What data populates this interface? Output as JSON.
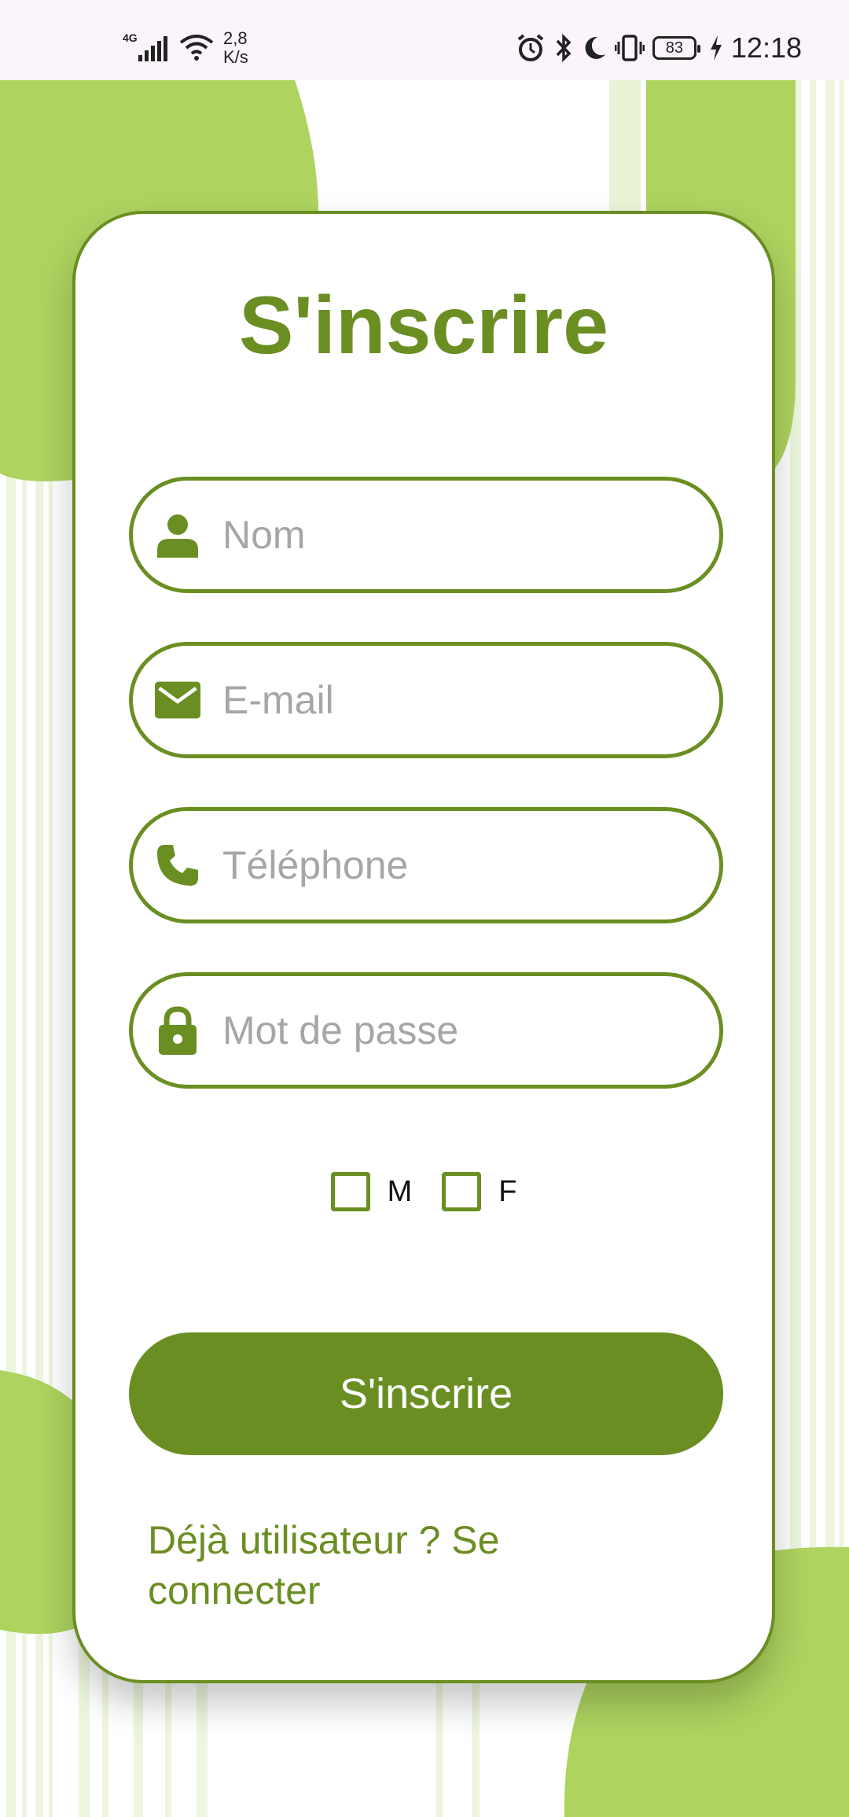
{
  "status_bar": {
    "network_type": "4G",
    "speed_value": "2,8",
    "speed_unit": "K/s",
    "battery_level": "83",
    "time": "12:18"
  },
  "form": {
    "title": "S'inscrire",
    "fields": [
      {
        "name": "name",
        "placeholder": "Nom",
        "icon": "person-icon"
      },
      {
        "name": "email",
        "placeholder": "E-mail",
        "icon": "mail-icon"
      },
      {
        "name": "phone",
        "placeholder": "Téléphone",
        "icon": "phone-icon"
      },
      {
        "name": "password",
        "placeholder": "Mot de passe",
        "icon": "lock-icon"
      }
    ],
    "gender_options": [
      {
        "label": "M",
        "checked": false
      },
      {
        "label": "F",
        "checked": false
      }
    ],
    "submit_label": "S'inscrire",
    "login_link": "Déjà utilisateur ? Se connecter"
  },
  "colors": {
    "accent": "#6b8e23",
    "decor_light": "#aed35f",
    "status_bar_bg": "#fbf4fb",
    "placeholder": "#a6a6a6"
  }
}
